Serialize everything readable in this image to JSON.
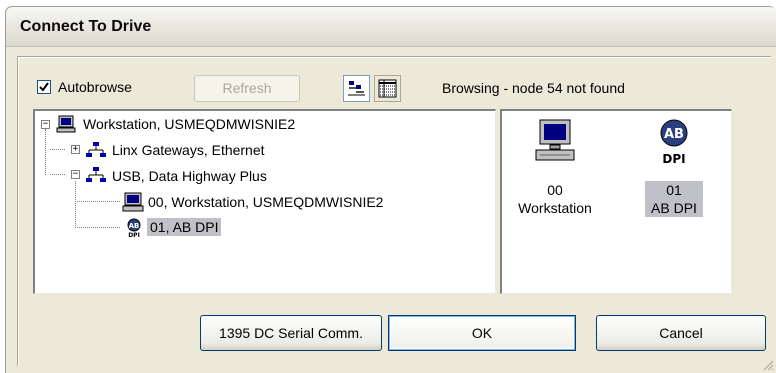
{
  "window": {
    "title": "Connect To Drive"
  },
  "toolbar": {
    "autobrowse_label": "Autobrowse",
    "autobrowse_checked": true,
    "refresh_label": "Refresh",
    "status_text": "Browsing - node 54 not found",
    "view_icons": [
      "small-icons-view-icon",
      "details-view-icon"
    ]
  },
  "tree": {
    "root": {
      "label": "Workstation, USMEQDMWISNIE2",
      "icon": "workstation-icon",
      "expanded": true
    },
    "children": [
      {
        "label": "Linx Gateways, Ethernet",
        "icon": "network-icon",
        "expanded": false
      },
      {
        "label": "USB, Data Highway Plus",
        "icon": "network-icon",
        "expanded": true,
        "children": [
          {
            "label": "00, Workstation, USMEQDMWISNIE2",
            "icon": "computer-icon"
          },
          {
            "label": "01, AB DPI",
            "icon": "ab-dpi-icon",
            "selected": true
          }
        ]
      }
    ]
  },
  "devices": [
    {
      "node": "00",
      "name": "Workstation",
      "icon": "computer-icon",
      "selected": false
    },
    {
      "node": "01",
      "name": "AB DPI",
      "icon": "ab-dpi-icon",
      "selected": true
    }
  ],
  "buttons": {
    "serial_label": "1395 DC Serial Comm.",
    "ok_label": "OK",
    "cancel_label": "Cancel"
  },
  "colors": {
    "dialog_bg": "#ece9d8",
    "selection": "#c0c0c8",
    "button_border": "#003c74"
  }
}
